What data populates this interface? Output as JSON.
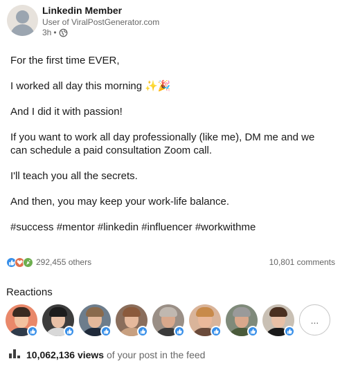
{
  "author": {
    "name": "Linkedin Member",
    "subtitle": "User of ViralPostGenerator.com",
    "time": "3h",
    "separator": "•",
    "visibility_icon": "globe-icon"
  },
  "post": {
    "paragraphs": [
      "For the first time EVER,",
      "I worked all day this morning ✨🎉",
      "And I did it with passion!",
      "If you want to work all day professionally (like me), DM me and we can schedule a paid consultation Zoom call.",
      "I'll teach you all the secrets.",
      "And then, you may keep your work-life balance.",
      "#success #mentor #linkedin #influencer #workwithme"
    ]
  },
  "stats": {
    "reaction_types": [
      "like-icon",
      "love-icon",
      "celebrate-icon"
    ],
    "reactions_count": "292,455 others",
    "comments_count": "10,801 comments"
  },
  "reactions": {
    "title": "Reactions",
    "more_label": "...",
    "reactors": [
      {
        "bg": "#e9886a",
        "skin": "#f2c2a0",
        "hair": "#3a2a20",
        "shirt": "#2f3b4a"
      },
      {
        "bg": "#3d3d3d",
        "skin": "#e8c0a6",
        "hair": "#1c1c1c",
        "shirt": "#d8d8d8"
      },
      {
        "bg": "#6d7d8c",
        "skin": "#e3b89a",
        "hair": "#8a6a4c",
        "shirt": "#1f2a3a"
      },
      {
        "bg": "#8a6e5c",
        "skin": "#e6b99c",
        "hair": "#8b5a3c",
        "shirt": "#c8a080"
      },
      {
        "bg": "#9a8f86",
        "skin": "#d8a88c",
        "hair": "#c0b8b0",
        "shirt": "#3a3a3a"
      },
      {
        "bg": "#d9b49a",
        "skin": "#eab89a",
        "hair": "#c88a4a",
        "shirt": "#6a4a3a"
      },
      {
        "bg": "#7f8a7a",
        "skin": "#d9a88c",
        "hair": "#9a9a9a",
        "shirt": "#4a5a3a"
      },
      {
        "bg": "#c9c0b4",
        "skin": "#e8c0a6",
        "hair": "#4a3020",
        "shirt": "#1a1a1a"
      }
    ]
  },
  "views": {
    "count": "10,062,136 views",
    "suffix": "of your post in the feed",
    "icon": "bar-chart-icon"
  },
  "colors": {
    "like": "#378fe9",
    "love": "#df704d",
    "celebrate": "#6dae4f"
  }
}
